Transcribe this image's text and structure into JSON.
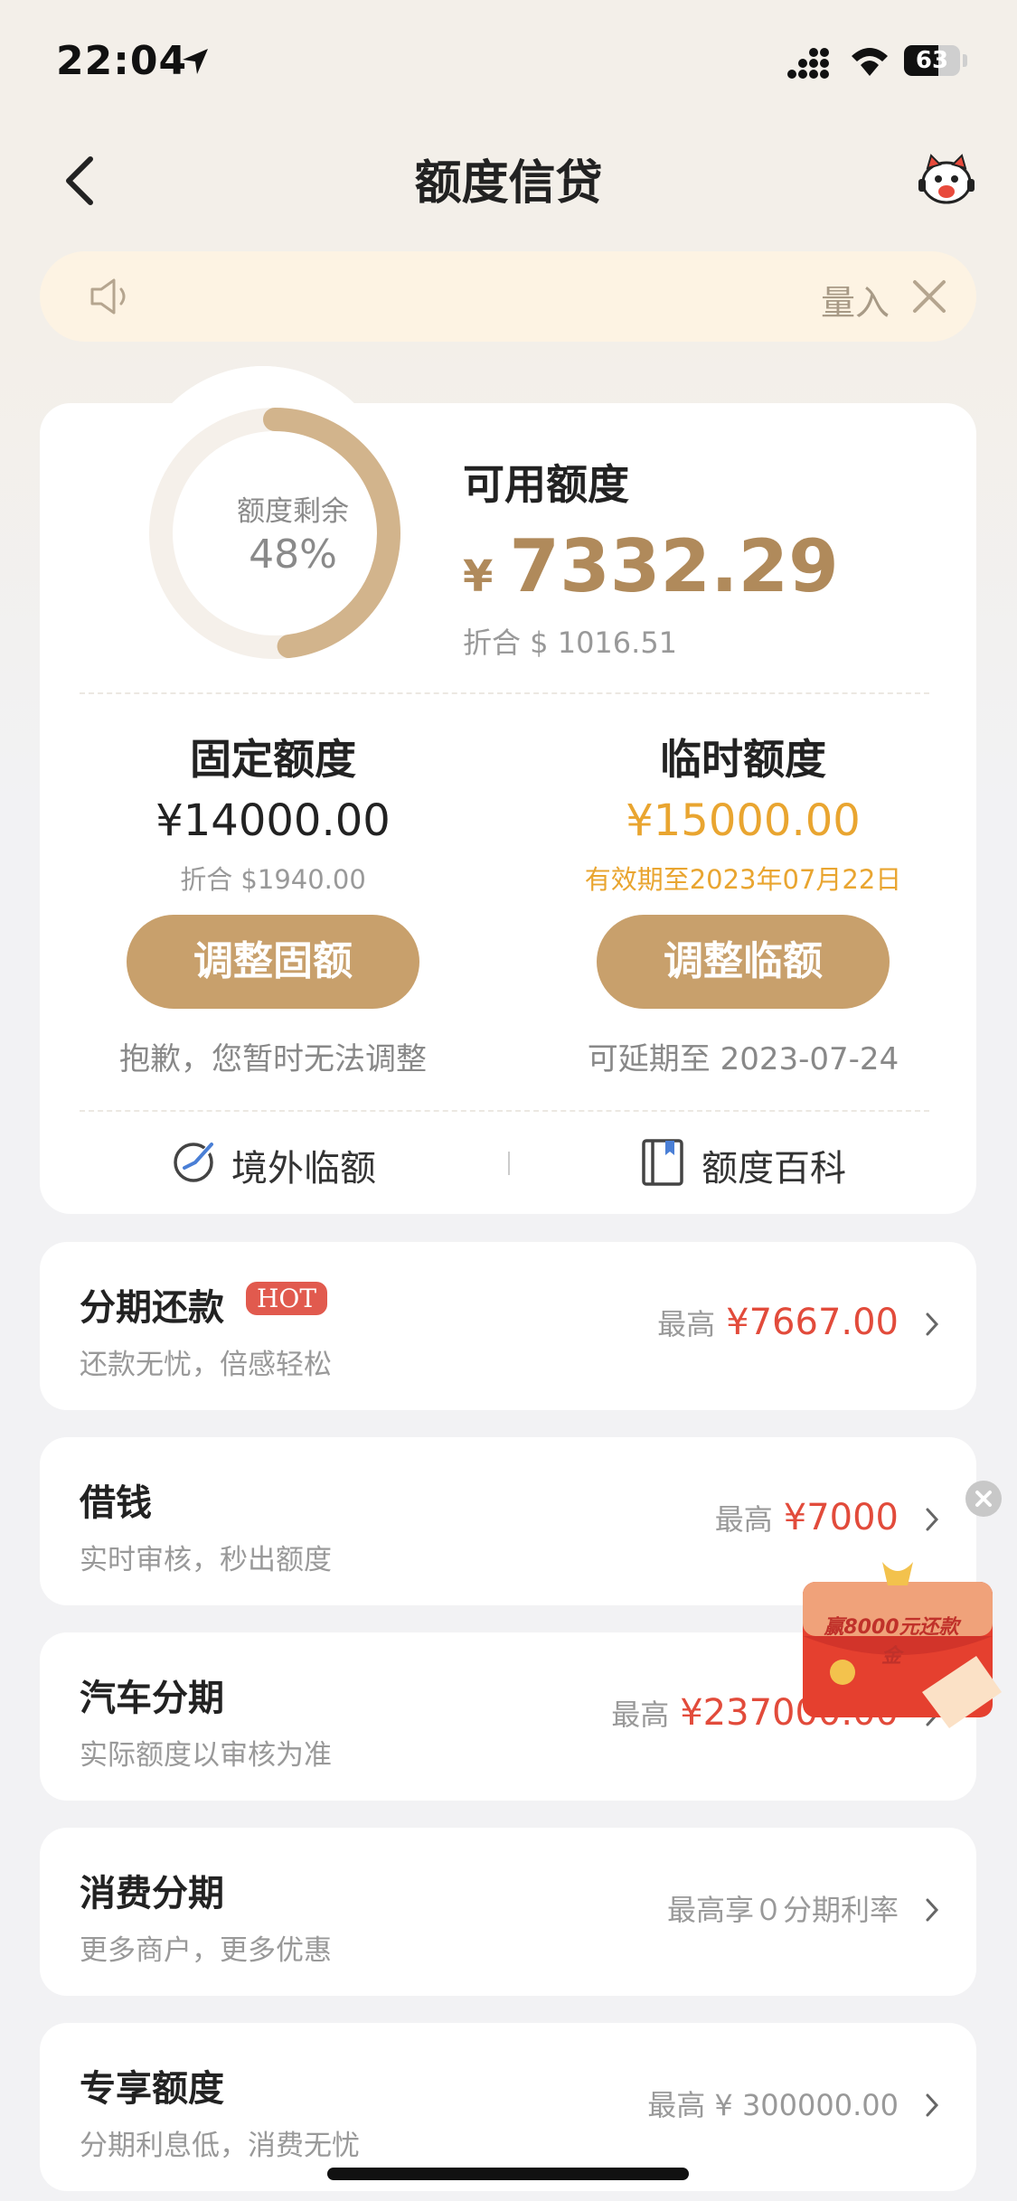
{
  "status_bar": {
    "time": "22:04",
    "battery": "63"
  },
  "nav": {
    "title": "额度信贷"
  },
  "notice": {
    "text": "量入"
  },
  "quota": {
    "ring_label": "额度剩余",
    "ring_percent_text": "48%",
    "remaining_fraction": 0.48,
    "available_label": "可用额度",
    "currency": "¥",
    "available_amount": "7332.29",
    "available_usd": "折合 $ 1016.51",
    "fixed": {
      "title": "固定额度",
      "amount": "¥14000.00",
      "sub": "折合 $1940.00",
      "button": "调整固额",
      "note": "抱歉，您暂时无法调整"
    },
    "temporary": {
      "title": "临时额度",
      "amount": "¥15000.00",
      "sub": "有效期至2023年07月22日",
      "button": "调整临额",
      "note": "可延期至 2023-07-24"
    },
    "links": {
      "overseas": "境外临额",
      "wiki": "额度百科"
    }
  },
  "items": [
    {
      "title": "分期还款",
      "badge": "HOT",
      "subtitle": "还款无忧，倍感轻松",
      "prefix": "最高",
      "amount": "¥7667.00"
    },
    {
      "title": "借钱",
      "subtitle": "实时审核，秒出额度",
      "prefix": "最高",
      "amount": "¥7000"
    },
    {
      "title": "汽车分期",
      "subtitle": "实际额度以审核为准",
      "prefix": "最高",
      "amount": "¥237000.00"
    },
    {
      "title": "消费分期",
      "subtitle": "更多商户，更多优惠",
      "text": "最高享０分期利率"
    },
    {
      "title": "专享额度",
      "subtitle": "分期利息低，消费无忧",
      "text": "最高 ¥ 300000.00"
    }
  ],
  "promo": {
    "text": "赢8000元还款金"
  },
  "colors": {
    "gold": "#c8a06c",
    "amount_gold": "#b08a5b",
    "temp_orange": "#e9a530",
    "red": "#e24b3b"
  }
}
